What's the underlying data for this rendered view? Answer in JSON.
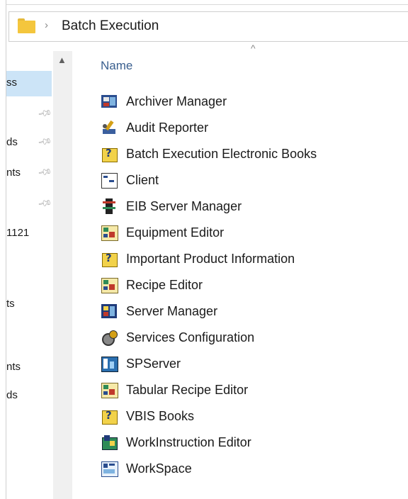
{
  "breadcrumb": {
    "separator": "›",
    "current": "Batch Execution"
  },
  "nav": {
    "items": [
      {
        "label": "ss",
        "selected": true
      },
      {
        "label": "",
        "pinned": true
      },
      {
        "label": "ds",
        "pinned": true
      },
      {
        "label": "nts",
        "pinned": true
      },
      {
        "label": "",
        "pinned": true
      },
      {
        "label": "1121"
      },
      {
        "label": "ts"
      },
      {
        "label": "nts"
      },
      {
        "label": "ds"
      }
    ],
    "scroll_up_glyph": "▲"
  },
  "list": {
    "sort_glyph": "^",
    "column_name": "Name",
    "files": [
      {
        "label": "Archiver Manager",
        "icon": "archiver-icon"
      },
      {
        "label": "Audit Reporter",
        "icon": "audit-icon"
      },
      {
        "label": "Batch Execution Electronic Books",
        "icon": "help-book-icon"
      },
      {
        "label": "Client",
        "icon": "client-icon"
      },
      {
        "label": "EIB Server Manager",
        "icon": "server-icon"
      },
      {
        "label": "Equipment Editor",
        "icon": "editor-icon"
      },
      {
        "label": "Important Product Information",
        "icon": "help-book-icon"
      },
      {
        "label": "Recipe Editor",
        "icon": "editor-icon"
      },
      {
        "label": "Server Manager",
        "icon": "server-manager-icon"
      },
      {
        "label": "Services Configuration",
        "icon": "services-icon"
      },
      {
        "label": "SPServer",
        "icon": "spserver-icon"
      },
      {
        "label": "Tabular Recipe Editor",
        "icon": "editor-icon"
      },
      {
        "label": "VBIS Books",
        "icon": "help-book-icon"
      },
      {
        "label": "WorkInstruction Editor",
        "icon": "workinstruction-icon"
      },
      {
        "label": "WorkSpace",
        "icon": "workspace-icon"
      }
    ]
  },
  "colors": {
    "selected_nav": "#cce4f7",
    "header_text": "#3a5f8f",
    "folder": "#f4c63d"
  }
}
